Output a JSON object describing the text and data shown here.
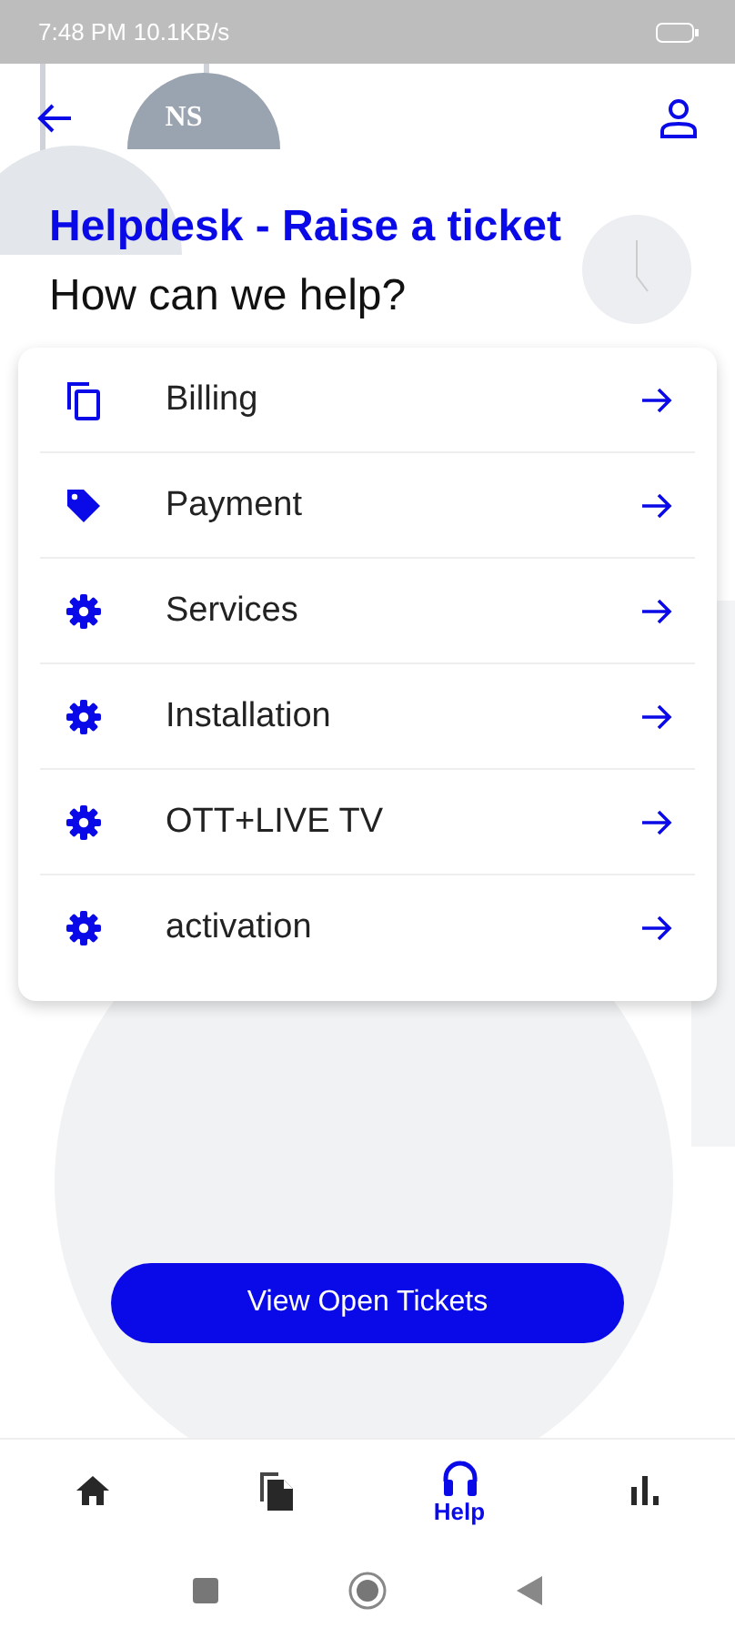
{
  "status_bar": {
    "time": "7:48 PM",
    "speed": "10.1KB/s"
  },
  "header": {
    "logo_text": "NS"
  },
  "title": "Helpdesk - Raise a ticket",
  "subtitle": "How can we help?",
  "categories": [
    {
      "label": "Billing",
      "kind": "copy"
    },
    {
      "label": "Payment",
      "kind": "tag"
    },
    {
      "label": "Services",
      "kind": "gear"
    },
    {
      "label": "Installation",
      "kind": "gear"
    },
    {
      "label": "OTT+LIVE TV",
      "kind": "gear"
    },
    {
      "label": "activation",
      "kind": "gear"
    }
  ],
  "action_button": "View Open Tickets",
  "bottom_nav": [
    {
      "kind": "home",
      "selected": false
    },
    {
      "kind": "documents",
      "selected": false
    },
    {
      "kind": "headphones",
      "label": "Help",
      "selected": true
    },
    {
      "kind": "chart",
      "selected": false
    }
  ]
}
